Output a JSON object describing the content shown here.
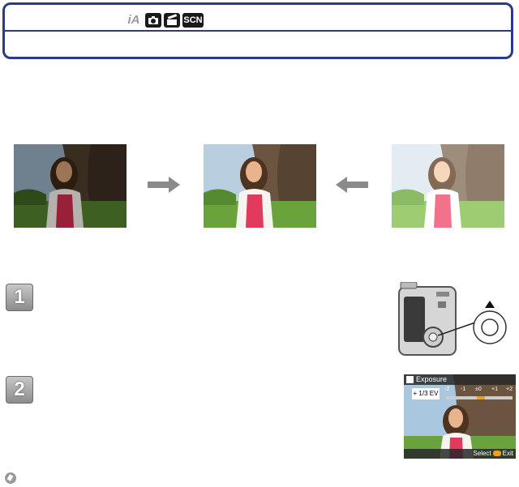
{
  "header": {
    "mode_icons": [
      "intelligent-auto-mode-icon",
      "normal-picture-mode-icon",
      "motion-picture-mode-icon",
      "scene-mode-icon"
    ],
    "ia_label": "iA",
    "scn_label": "SCN"
  },
  "illustration": {
    "photos": [
      "underexposed-photo",
      "correct-exposure-photo",
      "overexposed-photo"
    ],
    "arrows": [
      "right-arrow",
      "left-arrow"
    ]
  },
  "steps": [
    {
      "number": "1"
    },
    {
      "number": "2"
    }
  ],
  "lcd": {
    "title": "Exposure",
    "ev_value": "+ 1/3 EV",
    "scale": [
      "-2",
      "-1",
      "±0",
      "+1",
      "+2"
    ],
    "footer": "Select",
    "footer_exit": "Exit"
  },
  "colors": {
    "frame": "#2a3a8c",
    "accent": "#e8a020"
  }
}
